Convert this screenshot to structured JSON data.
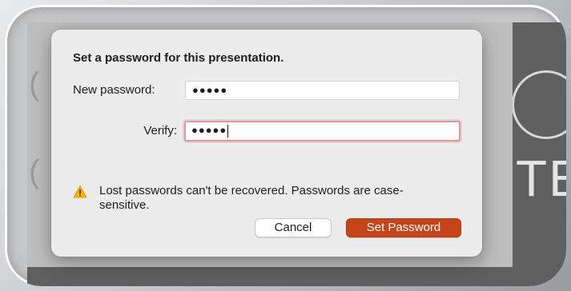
{
  "dialog": {
    "title": "Set a password for this presentation.",
    "new_password_label": "New password:",
    "new_password_value": "●●●●●",
    "verify_label": "Verify:",
    "verify_value": "●●●●●",
    "warning_text": "Lost passwords can't be recovered. Passwords are case-sensitive.",
    "cancel_label": "Cancel",
    "set_password_label": "Set Password"
  },
  "background": {
    "slide_text": "TE",
    "slide_letter": "O"
  },
  "colors": {
    "primary_button": "#c4441b",
    "focus_ring": "#d99a9a",
    "warning_icon": "#f5b400"
  },
  "icons": {
    "warning": "warning-triangle-icon"
  }
}
